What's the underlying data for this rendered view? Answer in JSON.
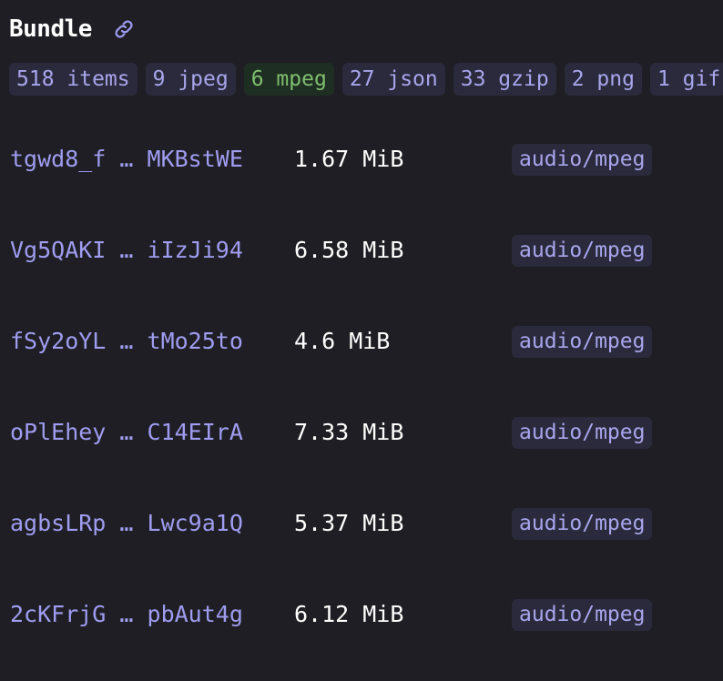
{
  "header": {
    "title": "Bundle"
  },
  "tags": [
    {
      "label": "518 items",
      "active": false
    },
    {
      "label": "9 jpeg",
      "active": false
    },
    {
      "label": "6 mpeg",
      "active": true
    },
    {
      "label": "27 json",
      "active": false
    },
    {
      "label": "33 gzip",
      "active": false
    },
    {
      "label": "2 png",
      "active": false
    },
    {
      "label": "1 gif",
      "active": false
    }
  ],
  "rows": [
    {
      "name": "tgwd8_f … MKBstWE",
      "size": "1.67 MiB",
      "type": "audio/mpeg"
    },
    {
      "name": "Vg5QAKI … iIzJi94",
      "size": "6.58 MiB",
      "type": "audio/mpeg"
    },
    {
      "name": "fSy2oYL … tMo25to",
      "size": "4.6 MiB",
      "type": "audio/mpeg"
    },
    {
      "name": "oPlEhey … C14EIrA",
      "size": "7.33 MiB",
      "type": "audio/mpeg"
    },
    {
      "name": "agbsLRp … Lwc9a1Q",
      "size": "5.37 MiB",
      "type": "audio/mpeg"
    },
    {
      "name": "2cKFrjG … pbAut4g",
      "size": "6.12 MiB",
      "type": "audio/mpeg"
    }
  ],
  "colors": {
    "background": "#1e1e24",
    "accent": "#a09cf0",
    "badge_bg": "#2a2a3c",
    "active_badge_bg": "#1f2e23",
    "active_badge_text": "#7fbf6e"
  },
  "icons": {
    "permalink": "link-icon"
  }
}
